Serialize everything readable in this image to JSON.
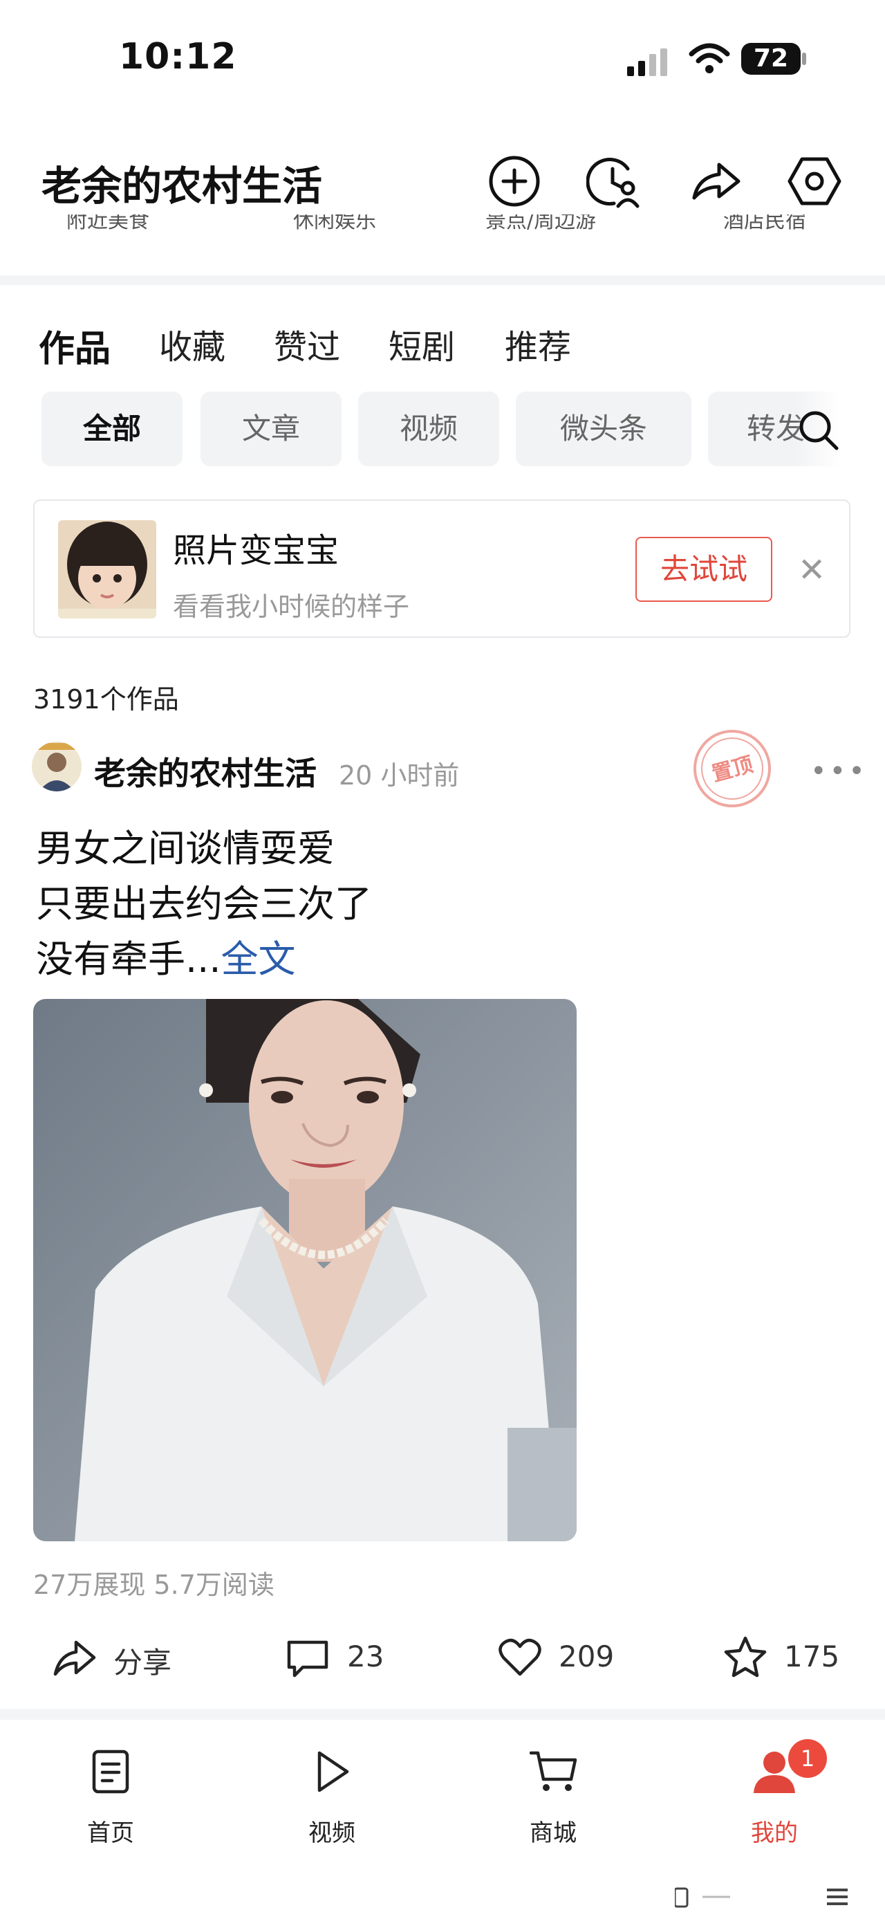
{
  "status_bar": {
    "time": "10:12",
    "battery": "72"
  },
  "header": {
    "title": "老余的农村生活",
    "actions": [
      {
        "name": "add-icon"
      },
      {
        "name": "history-user-icon"
      },
      {
        "name": "share-icon"
      },
      {
        "name": "settings-icon"
      }
    ]
  },
  "faded_categories": [
    "附近美食",
    "休闲娱乐",
    "景点/周边游",
    "酒店民宿"
  ],
  "tabs": [
    "作品",
    "收藏",
    "赞过",
    "短剧",
    "推荐"
  ],
  "filters": [
    "全部",
    "文章",
    "视频",
    "微头条",
    "转发"
  ],
  "promo": {
    "title": "照片变宝宝",
    "subtitle": "看看我小时候的样子",
    "button": "去试试"
  },
  "works_count": "3191个作品",
  "post": {
    "author": "老余的农村生活",
    "time": "20 小时前",
    "pinned_label": "置顶",
    "lines": [
      "男女之间谈情耍爱",
      "只要出去约会三次了",
      "没有牵手..."
    ],
    "full_text_link": "全文",
    "stats": "27万展现  5.7万阅读",
    "actions": {
      "share": "分享",
      "comments": "23",
      "likes": "209",
      "favorites": "175"
    }
  },
  "bottom_nav": {
    "items": [
      "首页",
      "视频",
      "商城",
      "我的"
    ],
    "active": "我的",
    "badge": "1"
  },
  "colors": {
    "accent": "#e0463b",
    "link": "#2a5caa",
    "muted": "#999999"
  }
}
